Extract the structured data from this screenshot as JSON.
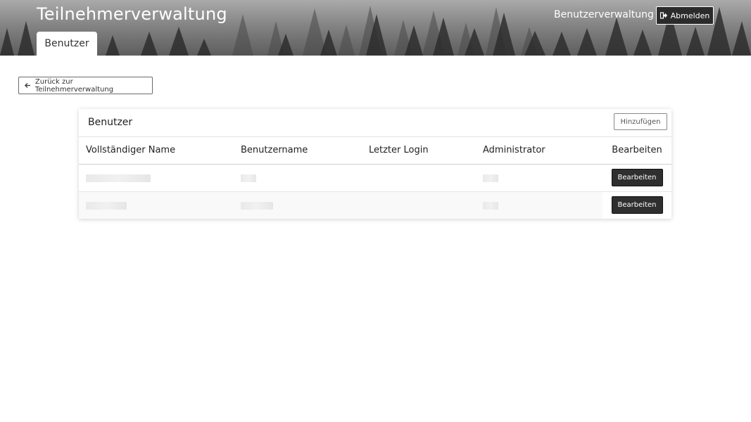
{
  "header": {
    "app_title": "Teilnehmerverwaltung",
    "nav_link": "Benutzerverwaltung",
    "logout_label": "Abmelden",
    "tab_label": "Benutzer"
  },
  "back_button": {
    "label": "Zurück zur Teilnehmerverwaltung"
  },
  "card": {
    "title": "Benutzer",
    "add_label": "Hinzufügen",
    "columns": [
      "Vollständiger Name",
      "Benutzername",
      "Letzter Login",
      "Administrator",
      "Bearbeiten"
    ],
    "rows": [
      {
        "full_name": "",
        "username": "",
        "last_login": "",
        "admin": "",
        "edit_label": "Bearbeiten"
      },
      {
        "full_name": "",
        "username": "",
        "last_login": "",
        "admin": "",
        "edit_label": "Bearbeiten"
      }
    ]
  },
  "colors": {
    "button_dark": "#2f2f2f",
    "header_gray": "#7d7d7d"
  },
  "icons": {
    "logout": "sign-out-icon",
    "back": "arrow-left-icon"
  }
}
